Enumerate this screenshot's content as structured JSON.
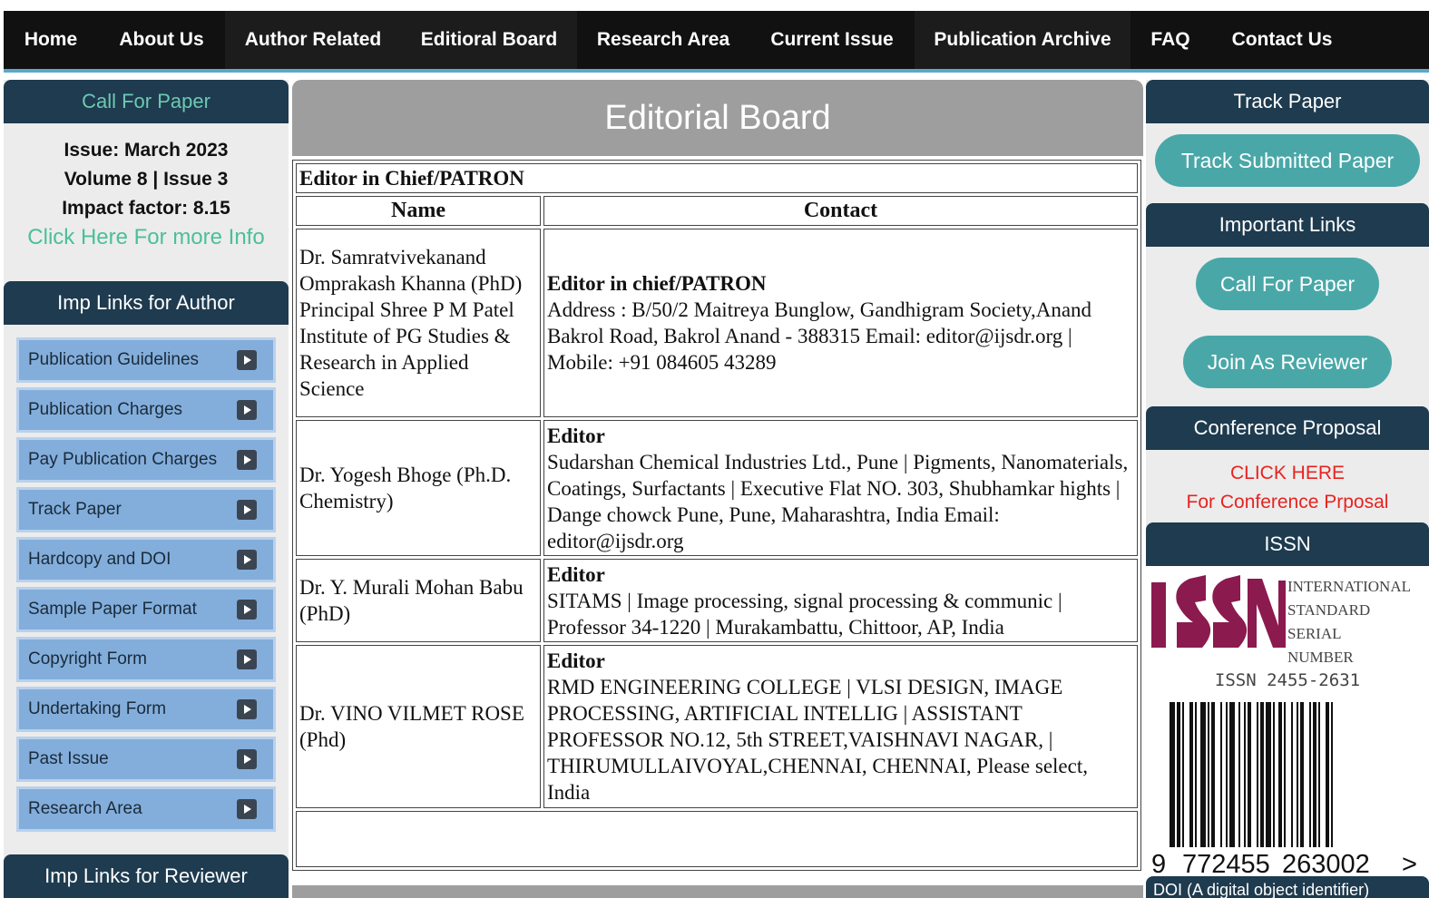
{
  "nav": [
    {
      "label": "Home",
      "dark": false,
      "w": 104
    },
    {
      "label": "About Us",
      "dark": false,
      "w": 140
    },
    {
      "label": "Author Related",
      "dark": true,
      "w": 194
    },
    {
      "label": "Editioral Board",
      "dark": true,
      "w": 194
    },
    {
      "label": "Research Area",
      "dark": false,
      "w": 190
    },
    {
      "label": "Current Issue",
      "dark": false,
      "w": 182
    },
    {
      "label": "Publication Archive",
      "dark": true,
      "w": 238
    },
    {
      "label": "FAQ",
      "dark": false,
      "w": 88
    },
    {
      "label": "Contact Us",
      "dark": false,
      "w": 158
    }
  ],
  "left": {
    "call_for_paper": "Call For Paper",
    "issue": "Issue: March 2023",
    "volume": "Volume 8 | Issue 3",
    "impact": "Impact factor: 8.15",
    "more_info": "Click Here For more Info",
    "imp_links_author": "Imp Links for Author",
    "links": [
      "Publication Guidelines",
      "Publication Charges",
      "Pay Publication Charges",
      "Track Paper",
      "Hardcopy and DOI",
      "Sample Paper Format",
      "Copyright Form",
      "Undertaking Form",
      "Past Issue",
      "Research Area"
    ],
    "imp_links_reviewer": "Imp Links for Reviewer"
  },
  "main": {
    "title": "Editorial Board",
    "caption": "Editor in Chief/PATRON",
    "col_name": "Name",
    "col_contact": "Contact",
    "rows": [
      {
        "name": "Dr. Samratvivekanand Omprakash Khanna (PhD) Principal Shree P M Patel Institute of PG Studies & Research in Applied Science",
        "role": "Editor in chief/PATRON",
        "details": "Address : B/50/2 Maitreya Bunglow, Gandhigram Society,Anand Bakrol Road, Bakrol Anand - 388315 Email: editor@ijsdr.org | Mobile: +91 084605 43289"
      },
      {
        "name": "Dr. Yogesh Bhoge (Ph.D. Chemistry)",
        "role": "Editor",
        "details": "Sudarshan Chemical Industries Ltd., Pune | Pigments, Nanomaterials, Coatings, Surfactants | Executive Flat NO. 303, Shubhamkar hights | Dange chowck Pune, Pune, Maharashtra, India Email: editor@ijsdr.org"
      },
      {
        "name": "Dr. Y. Murali Mohan Babu (PhD)",
        "role": "Editor",
        "details": "SITAMS | Image processing, signal processing & communic | Professor 34-1220 | Murakambattu, Chittoor, AP, India"
      },
      {
        "name": "Dr. VINO VILMET ROSE (Phd)",
        "role": "Editor",
        "details": "RMD ENGINEERING COLLEGE | VLSI DESIGN, IMAGE PROCESSING, ARTIFICIAL INTELLIG | ASSISTANT PROFESSOR NO.12, 5th STREET,VAISHNAVI NAGAR, | THIRUMULLAIVOYAL,CHENNAI, CHENNAI, Please select, India"
      }
    ]
  },
  "right": {
    "track_paper": "Track Paper",
    "track_submitted": "Track Submitted Paper",
    "important_links": "Important Links",
    "call_for_paper": "Call For Paper",
    "join_reviewer": "Join As Reviewer",
    "conference_proposal": "Conference Proposal",
    "click_here": "CLICK HERE",
    "for_conference": "For Conference Prposal",
    "issn_head": "ISSN",
    "issn_logo_words": [
      "INTERNATIONAL",
      "STANDARD",
      "SERIAL",
      "NUMBER"
    ],
    "issn_number": "ISSN 2455-2631",
    "barcode_digits": [
      "9",
      "772455",
      "263002",
      ">"
    ],
    "doi_head": "DOI (A digital object identifier)"
  },
  "colors": {
    "nav_bg": "#111111",
    "nav_accent": "#5aa9c9",
    "sidebar_head": "#1e3b4f",
    "link_button": "#83aedb",
    "pill": "#4aa7a8",
    "highlight_green": "#4bbf9a",
    "issn_magenta": "#8b1a4f",
    "alert_red": "#e8231f"
  }
}
